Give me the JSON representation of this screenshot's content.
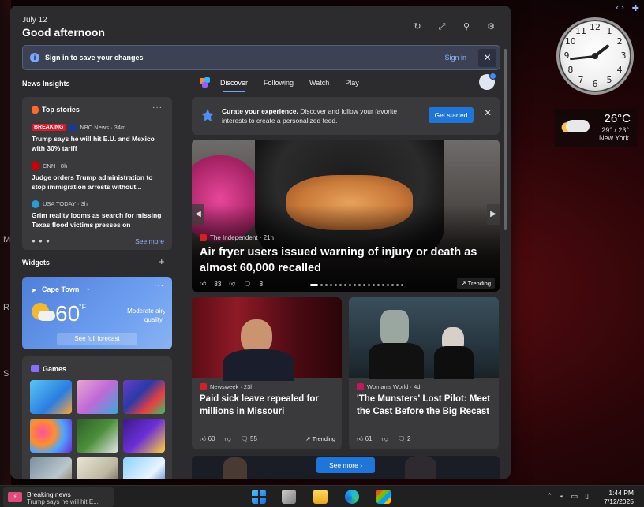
{
  "panel": {
    "date": "July 12",
    "greeting": "Good afternoon",
    "tools": [
      "refresh-icon",
      "expand-icon",
      "pin-icon",
      "gear-icon"
    ]
  },
  "signin_bar": {
    "message": "Sign in to save your changes",
    "link": "Sign in"
  },
  "news_insights": {
    "title": "News Insights",
    "card_title": "Top stories",
    "see_more": "See more",
    "stories": [
      {
        "badge": "BREAKING",
        "source": "NBC News · 34m",
        "headline": "Trump says he will hit E.U. and Mexico with 30% tariff"
      },
      {
        "source": "CNN · 8h",
        "headline": "Judge orders Trump administration to stop immigration arrests without..."
      },
      {
        "source": "USA TODAY · 3h",
        "headline": "Grim reality looms as search for missing Texas flood victims presses on"
      }
    ]
  },
  "widgets": {
    "title": "Widgets",
    "add": "+",
    "weather": {
      "city": "Cape Town",
      "temp": "60",
      "unit": "°F",
      "condition": "Moderate air quality",
      "forecast_link": "See full forecast"
    },
    "games": {
      "title": "Games"
    }
  },
  "feed": {
    "tabs": [
      "Discover",
      "Following",
      "Watch",
      "Play"
    ],
    "active_tab": "Discover",
    "curate": {
      "bold": "Curate your experience.",
      "text": " Discover and follow your favorite interests to create a personalized feed.",
      "button": "Get started"
    },
    "hero": {
      "source": "The Independent · 21h",
      "title": "Air fryer users issued warning of injury or death as almost 60,000 recalled",
      "likes": "83",
      "comments": "8",
      "tag": "Trending"
    },
    "cards": [
      {
        "source": "Newsweek · 23h",
        "title": "Paid sick leave repealed for millions in Missouri",
        "likes": "60",
        "comments": "55",
        "tag": "Trending"
      },
      {
        "source": "Woman's World · 4d",
        "title": "'The Munsters' Lost Pilot: Meet the Cast Before the Big Recast",
        "likes": "61",
        "comments": "2",
        "tag": ""
      }
    ],
    "see_more": "See more"
  },
  "desktop_weather": {
    "temp": "26°C",
    "range": "29° / 23°",
    "city": "New York"
  },
  "clock": {
    "numbers": [
      "12",
      "1",
      "2",
      "3",
      "4",
      "5",
      "6",
      "7",
      "8",
      "9",
      "10",
      "11"
    ],
    "hour": 1,
    "minute": 44
  },
  "taskbar": {
    "news_title": "Breaking news",
    "news_text": "Trump says he will hit E...",
    "time": "1:44 PM",
    "date": "7/12/2025"
  },
  "colors": {
    "accent": "#1f75d8",
    "breaking": "#d9182a",
    "panel": "#2c2c2e",
    "card": "#3a3a3c"
  }
}
